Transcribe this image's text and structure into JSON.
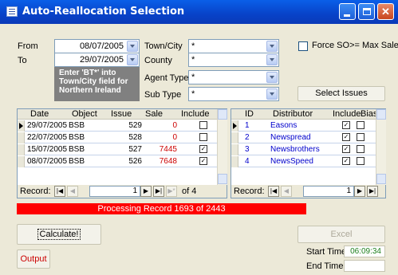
{
  "window": {
    "title": "Auto-Reallocation Selection",
    "titlebar_color": "#0842c8"
  },
  "filters": {
    "from_label": "From",
    "from_value": "08/07/2005",
    "to_label": "To",
    "to_value": "29/07/2005",
    "town_label": "Town/City",
    "town_value": "*",
    "county_label": "County",
    "county_value": "*",
    "agent_label": "Agent Type",
    "agent_value": "*",
    "subtype_label": "Sub Type",
    "subtype_value": "*",
    "hint": "Enter 'BT*' into Town/City field for Northern Ireland",
    "force_label": "Force SO>= Max Sale",
    "force_checked": false,
    "select_issues_label": "Select Issues"
  },
  "issues": {
    "columns": [
      "Date",
      "Object",
      "Issue",
      "Sale",
      "Include"
    ],
    "rows": [
      {
        "date": "29/07/2005",
        "object": "BSB",
        "issue": "529",
        "sale": "0",
        "include": false,
        "current": true
      },
      {
        "date": "22/07/2005",
        "object": "BSB",
        "issue": "528",
        "sale": "0",
        "include": false,
        "current": false
      },
      {
        "date": "15/07/2005",
        "object": "BSB",
        "issue": "527",
        "sale": "7445",
        "include": true,
        "current": false
      },
      {
        "date": "08/07/2005",
        "object": "BSB",
        "issue": "526",
        "sale": "7648",
        "include": true,
        "current": false
      }
    ],
    "record_label": "Record:",
    "record_current": "1",
    "record_total": "of 4"
  },
  "distributors": {
    "columns": [
      "ID",
      "Distributor",
      "Include",
      "Bias"
    ],
    "rows": [
      {
        "id": "1",
        "name": "Easons",
        "include": true,
        "bias": false,
        "current": true
      },
      {
        "id": "2",
        "name": "Newspread",
        "include": true,
        "bias": false,
        "current": false
      },
      {
        "id": "3",
        "name": "Newsbrothers",
        "include": true,
        "bias": false,
        "current": false
      },
      {
        "id": "4",
        "name": "NewsSpeed",
        "include": true,
        "bias": false,
        "current": false
      }
    ],
    "record_label": "Record:",
    "record_current": "1"
  },
  "progress": {
    "text": "Processing Record 1693 of 2443",
    "color": "#ff0000"
  },
  "actions": {
    "calculate_label": "Calculate!",
    "output_label": "Output",
    "excel_label": "Excel",
    "start_time_label": "Start Time",
    "start_time_value": "06:09:34",
    "end_time_label": "End Time",
    "end_time_value": ""
  }
}
